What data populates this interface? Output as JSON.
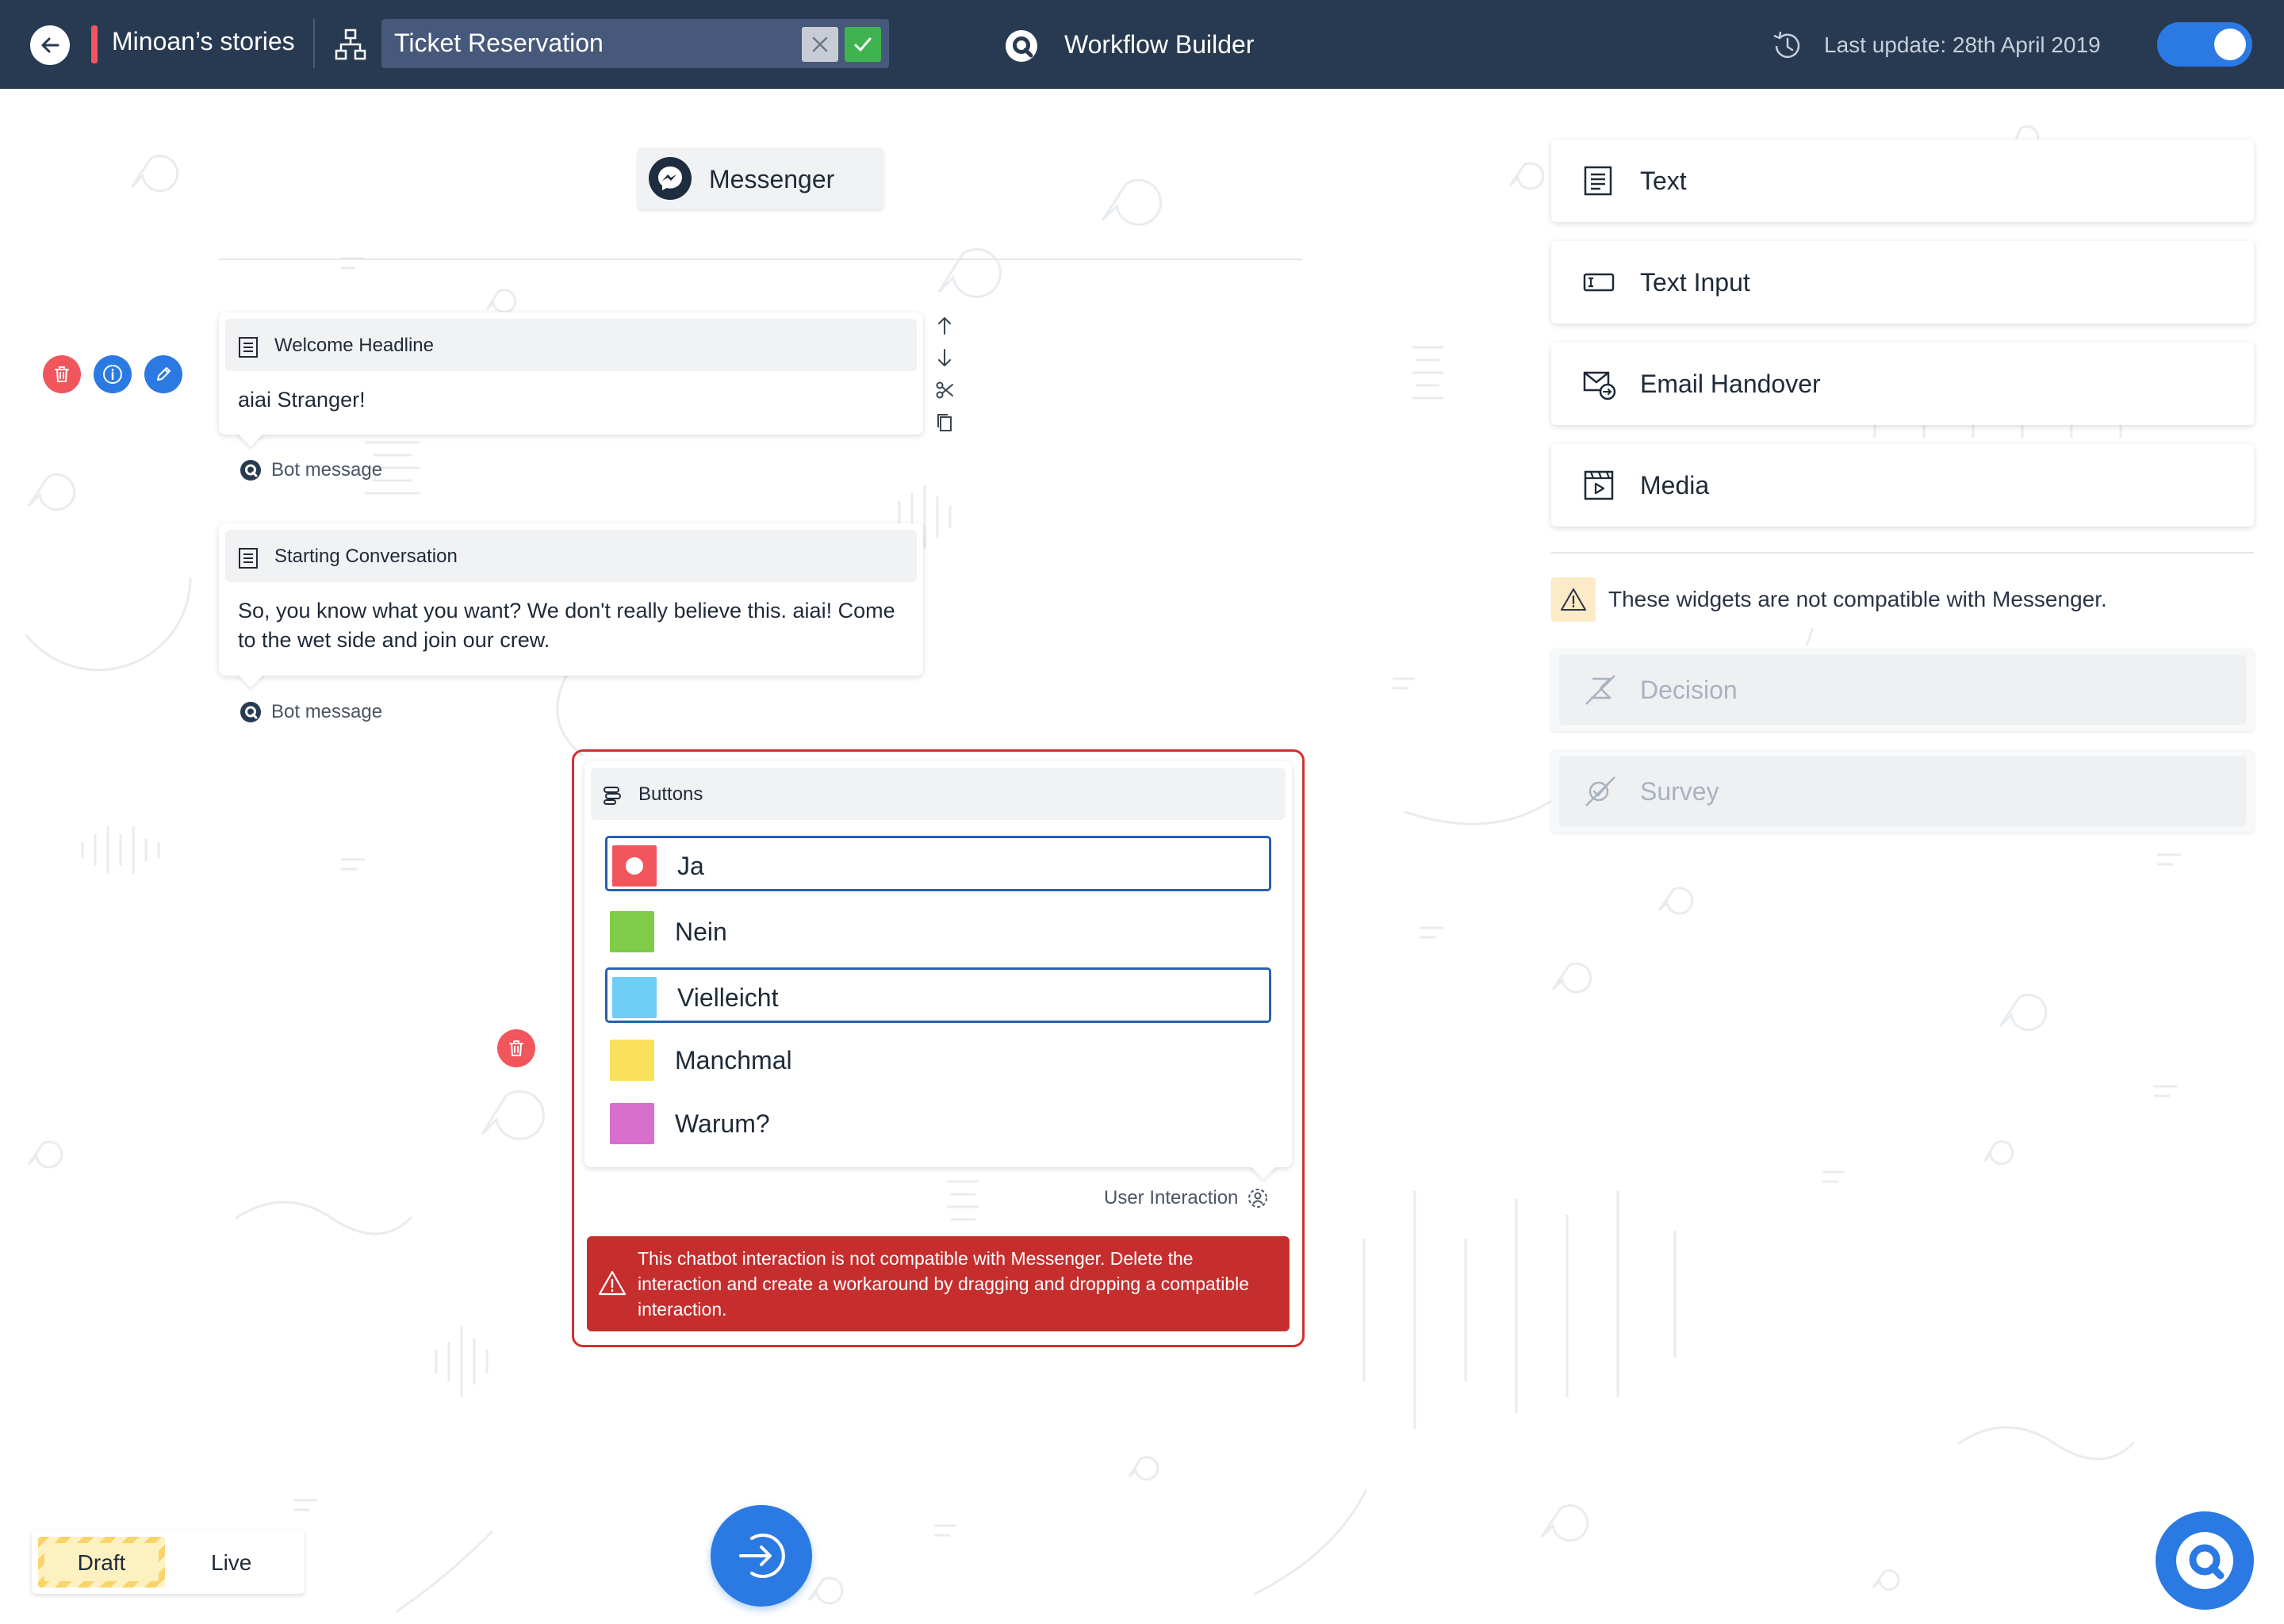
{
  "header": {
    "story_name": "Minoan’s stories",
    "ticket_value": "Ticket Reservation",
    "app_title": "Workflow Builder",
    "last_update": "Last update: 28th April 2019",
    "toggle_on": true
  },
  "channel": {
    "label": "Messenger"
  },
  "canvas": {
    "cards": [
      {
        "title": "Welcome Headline",
        "body": "aiai Stranger!",
        "sub_label": "Bot message"
      },
      {
        "title": "Starting Conversation",
        "body": "So, you know what you want? We don't really believe this. aiai! Come to the wet side and join our crew.",
        "sub_label": "Bot message"
      }
    ],
    "buttons_block": {
      "title": "Buttons",
      "options": [
        {
          "label": "Ja",
          "color": "#f1565d",
          "selected": true
        },
        {
          "label": "Nein",
          "color": "#7fcc48",
          "selected": false
        },
        {
          "label": "Vielleicht",
          "color": "#6ecef5",
          "selected": true
        },
        {
          "label": "Manchmal",
          "color": "#fbe05c",
          "selected": false
        },
        {
          "label": "Warum?",
          "color": "#d86fcc",
          "selected": false
        }
      ],
      "sub_label": "User Interaction",
      "error": "This chatbot interaction is not compatible with Messenger. Delete the interaction and create a workaround by dragging and dropping a compatible interaction."
    }
  },
  "panel": {
    "widgets": [
      {
        "label": "Text",
        "icon": "text-icon"
      },
      {
        "label": "Text Input",
        "icon": "text-input-icon"
      },
      {
        "label": "Email Handover",
        "icon": "email-handover-icon"
      },
      {
        "label": "Media",
        "icon": "media-icon"
      }
    ],
    "warning": "These widgets are not compatible with Messenger.",
    "disabled_widgets": [
      {
        "label": "Decision",
        "icon": "decision-icon"
      },
      {
        "label": "Survey",
        "icon": "survey-icon"
      }
    ]
  },
  "mode": {
    "draft": "Draft",
    "live": "Live",
    "active": "draft"
  },
  "colors": {
    "header_bg": "#283a51",
    "accent_blue": "#2b79e2",
    "danger_red": "#c62e2e",
    "warning_bg": "#fdeac6"
  }
}
